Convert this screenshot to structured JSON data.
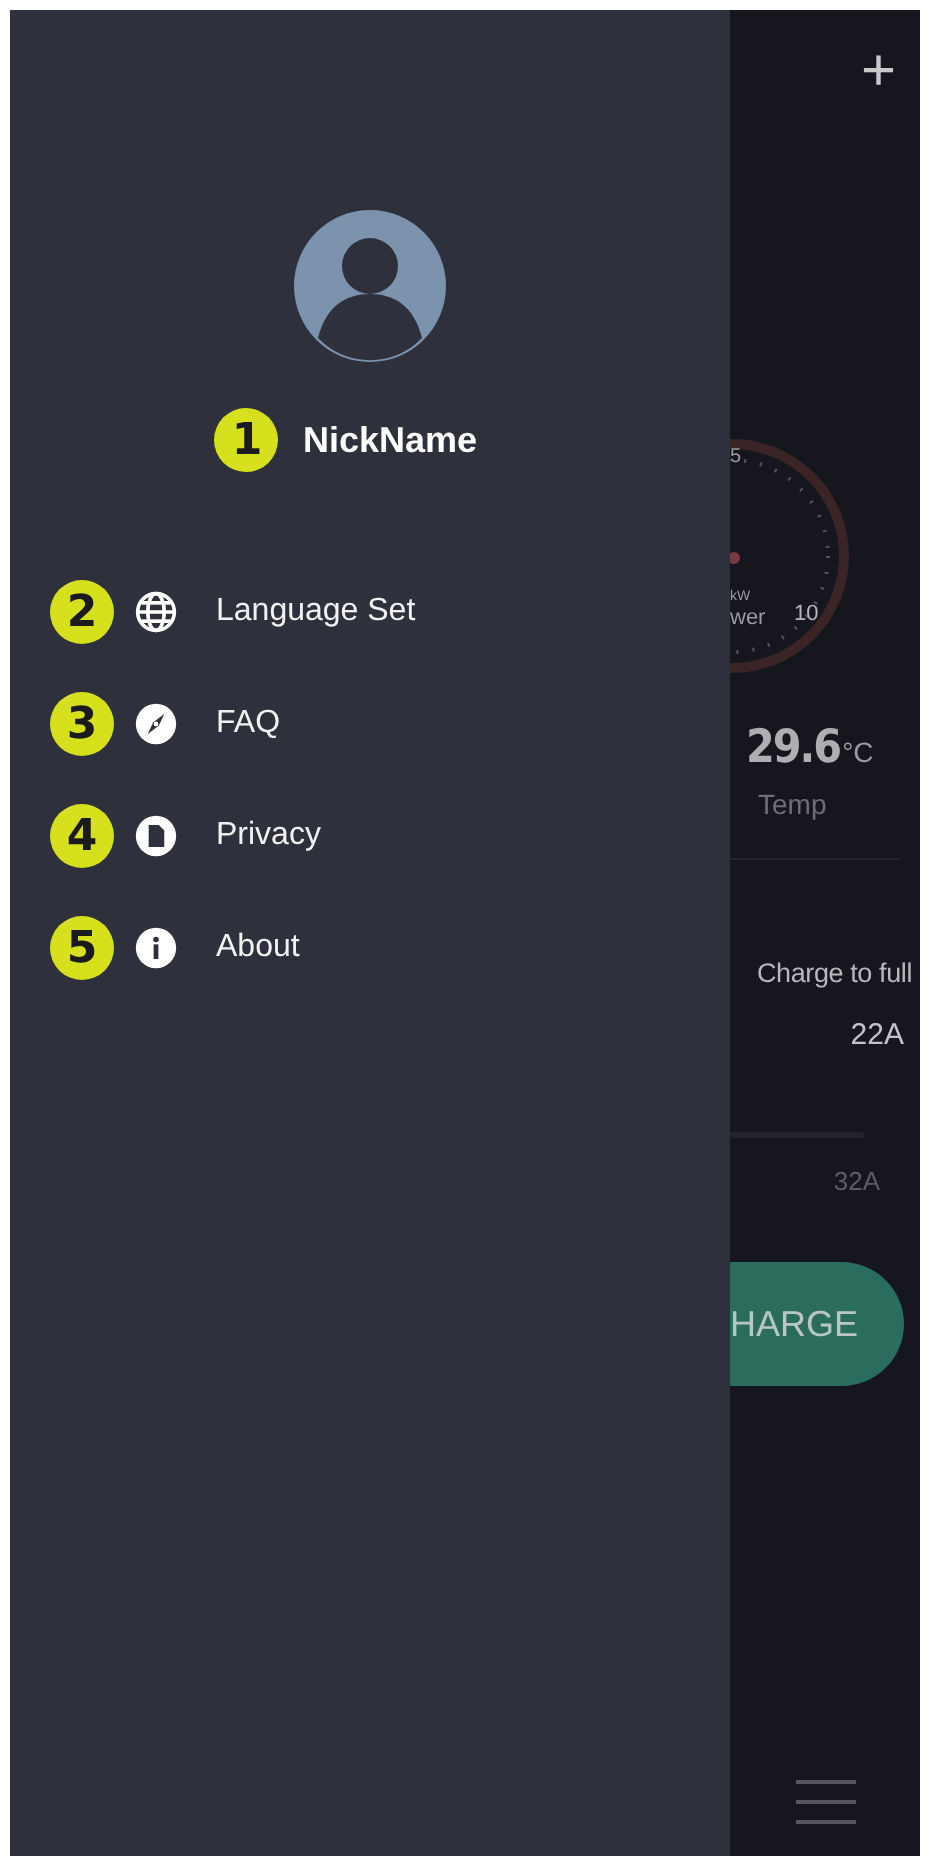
{
  "drawer": {
    "profile": {
      "badge": "1",
      "name": "NickName"
    },
    "menu": [
      {
        "badge": "2",
        "label": "Language Set"
      },
      {
        "badge": "3",
        "label": "FAQ"
      },
      {
        "badge": "4",
        "label": "Privacy"
      },
      {
        "badge": "5",
        "label": "About"
      }
    ]
  },
  "background": {
    "add": "+",
    "gauge": {
      "tick_5": "5",
      "unit": "kW",
      "label": "wer",
      "tick_10": "10"
    },
    "temperature": {
      "value": "29.6",
      "unit": "°C",
      "label": "Temp"
    },
    "charge_mode": "Charge to full",
    "current": "22A",
    "max_current": "32A",
    "button": "HARGE"
  }
}
